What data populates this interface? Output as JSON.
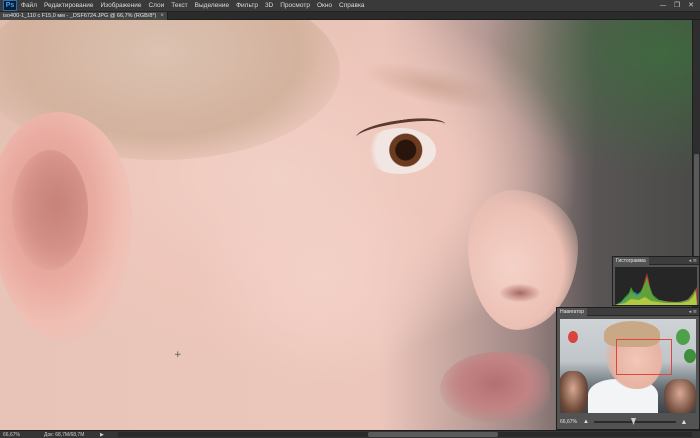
{
  "app": {
    "logo": "Ps",
    "menu": [
      "Файл",
      "Редактирование",
      "Изображение",
      "Слои",
      "Текст",
      "Выделение",
      "Фильтр",
      "3D",
      "Просмотр",
      "Окно",
      "Справка"
    ],
    "window_controls": [
      "—",
      "❐",
      "✕"
    ]
  },
  "document": {
    "tab_title": "iso400-1_110 c F15,0 мм - _DSF6724.JPG @ 66,7% (RGB/8*)",
    "tab_close": "×"
  },
  "status": {
    "zoom": "66,67%",
    "doc_info": "Док: 68,7M/68,7M",
    "arrow": "▶"
  },
  "panels": {
    "histogram": {
      "title": "Гистограмма",
      "controls": "◂ ≡"
    },
    "navigator": {
      "title": "Навигатор",
      "controls": "◂ ≡",
      "zoom": "66,67%",
      "zoom_out": "▲",
      "zoom_in": "▲",
      "zoom_level": 0.48
    }
  },
  "colors": {
    "view_box": "#e0463c",
    "panel_bg": "#535353",
    "menubar_bg": "#3a3a3a"
  },
  "icons": {
    "canvas_cursor": "crosshair-icon"
  }
}
